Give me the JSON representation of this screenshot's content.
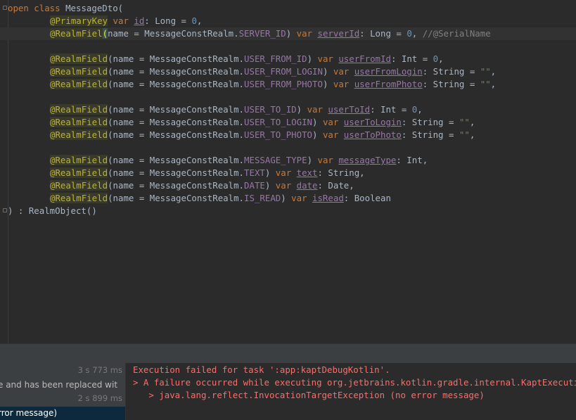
{
  "editor": {
    "line1": {
      "kw": "open class",
      "name": " MessageDto("
    },
    "line2": {
      "ann": "@PrimaryKey",
      "kw": " var ",
      "prop": "id",
      "rest": ": Long = ",
      "num": "0",
      "end": ","
    },
    "line3": {
      "ann": "@RealmFiel",
      "hl": "(",
      "a": "name = MessageConstRealm.",
      "c": "SERVER_ID",
      "b": ") ",
      "kw": "var ",
      "prop": "serverId",
      "rest": ": Long = ",
      "num": "0",
      "end": ", ",
      "comment": "//@SerialName"
    },
    "line4": {
      "ann": "@RealmField",
      "a": "(name = MessageConstRealm.",
      "c": "USER_FROM_ID",
      "b": ") ",
      "kw": "var ",
      "prop": "userFromId",
      "rest": ": Int = ",
      "num": "0",
      "end": ","
    },
    "line5": {
      "ann": "@RealmField",
      "a": "(name = MessageConstRealm.",
      "c": "USER_FROM_LOGIN",
      "b": ") ",
      "kw": "var ",
      "prop": "userFromLogin",
      "rest": ": String = ",
      "str": "\"\"",
      "end": ","
    },
    "line6": {
      "ann": "@RealmField",
      "a": "(name = MessageConstRealm.",
      "c": "USER_FROM_PHOTO",
      "b": ") ",
      "kw": "var ",
      "prop": "userFromPhoto",
      "rest": ": String = ",
      "str": "\"\"",
      "end": ","
    },
    "line7": {
      "ann": "@RealmField",
      "a": "(name = MessageConstRealm.",
      "c": "USER_TO_ID",
      "b": ") ",
      "kw": "var ",
      "prop": "userToId",
      "rest": ": Int = ",
      "num": "0",
      "end": ","
    },
    "line8": {
      "ann": "@RealmField",
      "a": "(name = MessageConstRealm.",
      "c": "USER_TO_LOGIN",
      "b": ") ",
      "kw": "var ",
      "prop": "userToLogin",
      "rest": ": String = ",
      "str": "\"\"",
      "end": ","
    },
    "line9": {
      "ann": "@RealmField",
      "a": "(name = MessageConstRealm.",
      "c": "USER_TO_PHOTO",
      "b": ") ",
      "kw": "var ",
      "prop": "userToPhoto",
      "rest": ": String = ",
      "str": "\"\"",
      "end": ","
    },
    "line10": {
      "ann": "@RealmField",
      "a": "(name = MessageConstRealm.",
      "c": "MESSAGE_TYPE",
      "b": ") ",
      "kw": "var ",
      "prop": "messageType",
      "rest": ": Int,"
    },
    "line11": {
      "ann": "@RealmField",
      "a": "(name = MessageConstRealm.",
      "c": "TEXT",
      "b": ") ",
      "kw": "var ",
      "prop": "text",
      "rest": ": String,"
    },
    "line12": {
      "ann": "@RealmField",
      "a": "(name = MessageConstRealm.",
      "c": "DATE",
      "b": ") ",
      "kw": "var ",
      "prop": "date",
      "rest": ": Date,"
    },
    "line13": {
      "ann": "@RealmField",
      "a": "(name = MessageConstRealm.",
      "c": "IS_READ",
      "b": ") ",
      "kw": "var ",
      "prop": "isRead",
      "rest": ": Boolean"
    },
    "line14": {
      "text": ") : RealmObject()"
    }
  },
  "build": {
    "rows": [
      {
        "time": "3 s 773 ms",
        "msg": ""
      },
      {
        "time": "",
        "msg": "e and has been replaced wit"
      },
      {
        "time": "2 s 899 ms",
        "msg": ""
      },
      {
        "time": "",
        "msg": "rror message)"
      }
    ],
    "output": [
      "Execution failed for task ':app:kaptDebugKotlin'.",
      "> A failure occurred while executing org.jetbrains.kotlin.gradle.internal.KaptExecution",
      "   > java.lang.reflect.InvocationTargetException (no error message)"
    ]
  },
  "colors": {
    "background": "#2b2b2b",
    "keyword": "#cc7832",
    "annotation": "#bbb529",
    "property": "#9876aa",
    "error": "#ff6b68"
  }
}
